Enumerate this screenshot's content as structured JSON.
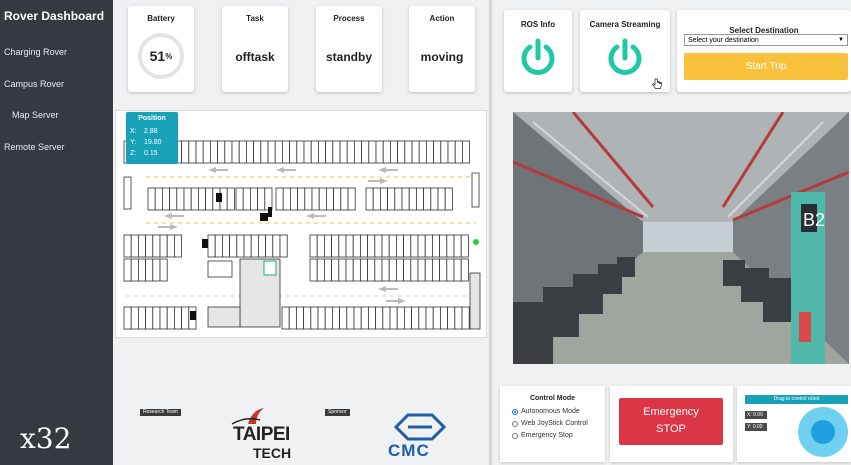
{
  "sidebar": {
    "title": "Rover Dashboard",
    "items": [
      {
        "label": "Charging Rover"
      },
      {
        "label": "Campus Rover"
      },
      {
        "label": "Map Server"
      },
      {
        "label": "Remote Server"
      }
    ],
    "footer": "x32"
  },
  "stats": {
    "battery": {
      "label": "Battery",
      "value": "51",
      "unit": "%"
    },
    "task": {
      "label": "Task",
      "value": "offtask"
    },
    "process": {
      "label": "Process",
      "value": "standby"
    },
    "action": {
      "label": "Action",
      "value": "moving"
    }
  },
  "ros_info": {
    "label": "ROS Info",
    "icon": "power-icon",
    "color": "#20c9a6"
  },
  "camera_streaming": {
    "label": "Camera Streaming",
    "icon": "power-icon",
    "color": "#20c9a6"
  },
  "destination": {
    "label": "Select Destination",
    "selected": "Select your destination",
    "button": "Start Trip",
    "button_color": "#f8c23a"
  },
  "position": {
    "title": "Position",
    "x_label": "X:",
    "x": "2.88",
    "y_label": "Y:",
    "y": "19.80",
    "z_label": "Z:",
    "z": "0.15"
  },
  "control_mode": {
    "title": "Control Mode",
    "options": [
      {
        "label": "Autonomous Mode",
        "selected": true
      },
      {
        "label": "Web JoyStick Control",
        "selected": false
      },
      {
        "label": "Emergency Stop",
        "selected": false
      }
    ]
  },
  "emergency": {
    "line1": "Emergency",
    "line2": "STOP",
    "color": "#dc3545"
  },
  "joystick": {
    "title": "Drag to control robot",
    "x_label": "X: 0.00",
    "y_label": "Y: 0.00"
  },
  "sponsors": {
    "research_team_tag": "Research Team",
    "sponsor_tag": "Sponsor",
    "taipei_text": "TAIPEI",
    "tech_text": "TECH",
    "cmc_text": "CMC"
  }
}
